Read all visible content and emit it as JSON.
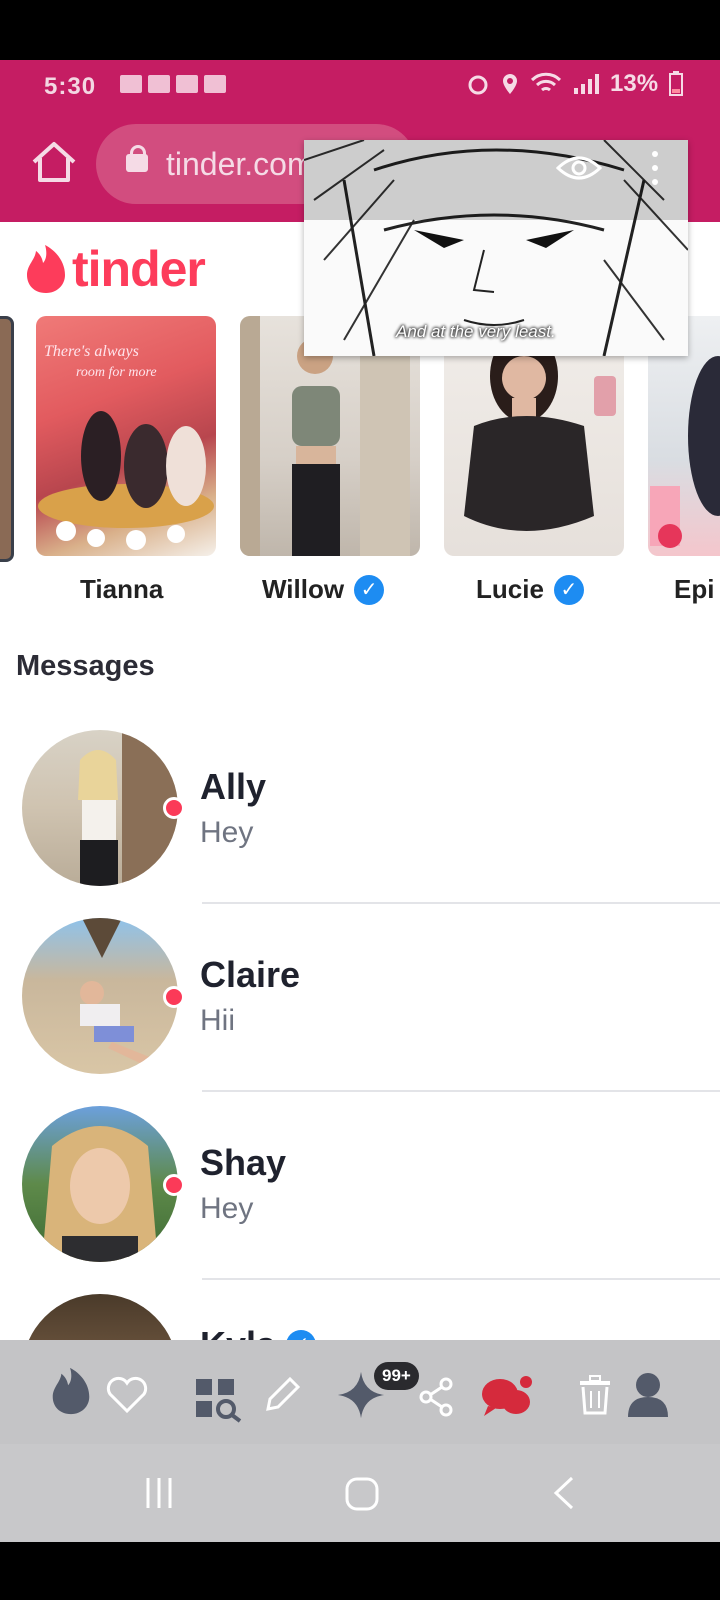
{
  "status_bar": {
    "time": "5:30",
    "battery": "13%"
  },
  "browser": {
    "url": "tinder.com"
  },
  "pip_video": {
    "subtitle": "And at the very least."
  },
  "app": {
    "logo_text": "tinder"
  },
  "matches": [
    {
      "name": "Tianna",
      "verified": false
    },
    {
      "name": "Willow",
      "verified": true
    },
    {
      "name": "Lucie",
      "verified": true
    },
    {
      "name": "Epi",
      "verified": false
    }
  ],
  "messages_section": {
    "title": "Messages",
    "items": [
      {
        "name": "Ally",
        "preview": "Hey",
        "unread": true
      },
      {
        "name": "Claire",
        "preview": "Hii",
        "unread": true
      },
      {
        "name": "Shay",
        "preview": "Hey",
        "unread": true
      },
      {
        "name": "Kyla",
        "preview": "",
        "verified": true
      }
    ]
  },
  "bottom_toolbar": {
    "badge": "99+",
    "icons": [
      "flame-icon",
      "heart-icon",
      "explore-icon",
      "edit-icon",
      "sparkle-icon",
      "share-icon",
      "chat-icon",
      "trash-icon",
      "profile-icon"
    ]
  },
  "colors": {
    "browser_bar": "#c51d63",
    "tinder_brand": "#fd3c5b",
    "verified_blue": "#1d8cf2",
    "unread_dot": "#fb3a58"
  }
}
